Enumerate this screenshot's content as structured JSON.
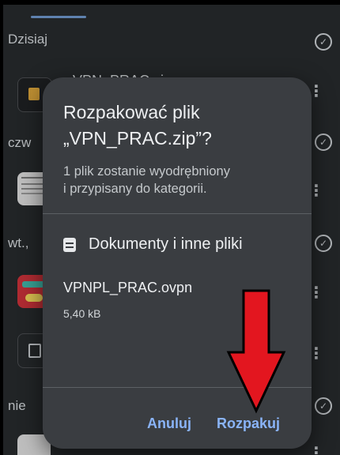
{
  "background_list": {
    "sections": [
      {
        "label": "Dzisiaj"
      },
      {
        "label": "czw"
      },
      {
        "label": "wt.,"
      },
      {
        "label": "nie"
      }
    ],
    "partial_file_title": "VPN_PRAC.zip"
  },
  "dialog": {
    "title_line1": "Rozpakować plik",
    "title_line2": "„VPN_PRAC.zip”?",
    "description_line1": "1 plik zostanie wyodrębniony",
    "description_line2": "i przypisany do kategorii.",
    "category_label": "Dokumenty i inne pliki",
    "file_name": "VPNPL_PRAC.ovpn",
    "file_size": "5,40 kB",
    "cancel_label": "Anuluj",
    "extract_label": "Rozpakuj"
  },
  "colors": {
    "dialog_bg": "#3a3d41",
    "button_accent": "#8ab4f8",
    "annotation_arrow": "#e3161f"
  },
  "icons": [
    "check-circle-icon",
    "more-vert-icon",
    "document-icon",
    "zip-icon",
    "file-icon"
  ]
}
